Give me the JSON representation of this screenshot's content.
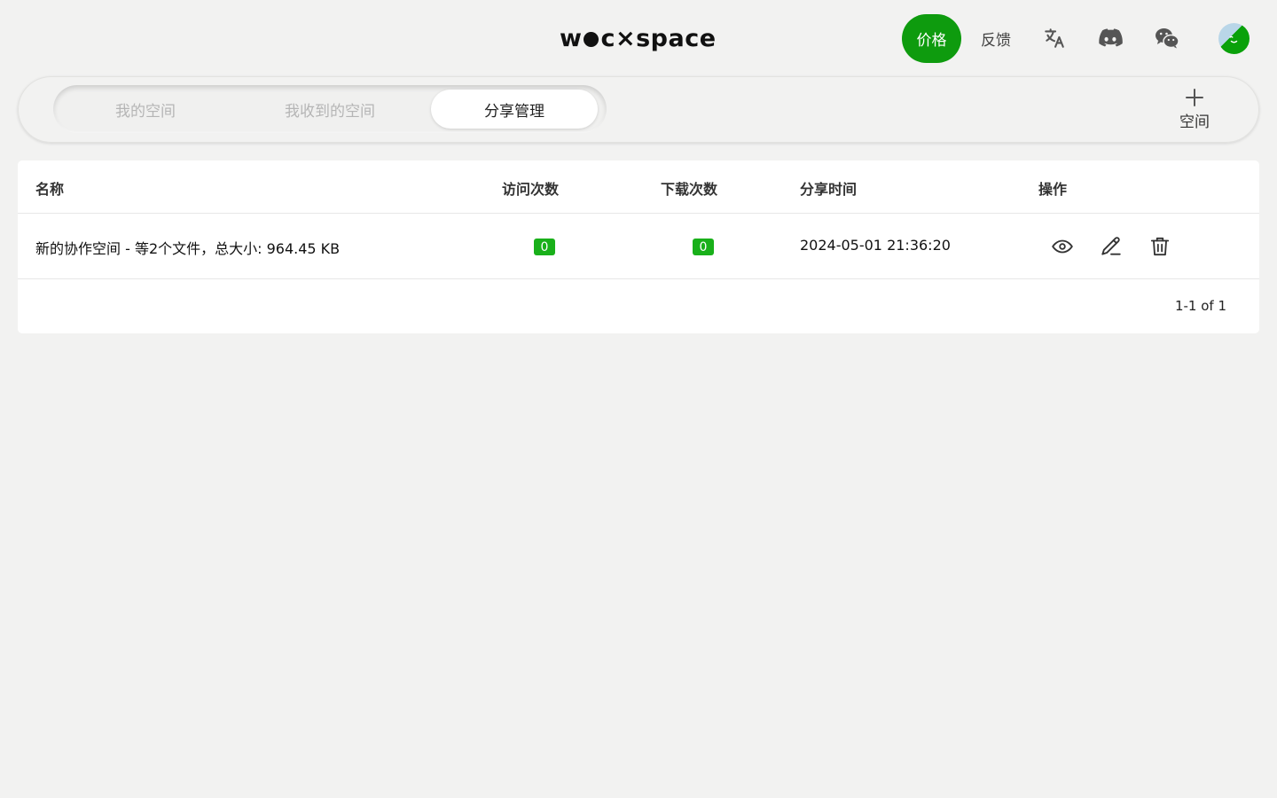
{
  "header": {
    "logo_left": "w",
    "logo_mid": "c",
    "logo_x": "×",
    "logo_right": "space",
    "price_label": "价格",
    "feedback_label": "反馈",
    "icons": [
      "translate-icon",
      "discord-icon",
      "wechat-icon"
    ]
  },
  "tabs": [
    {
      "label": "我的空间",
      "active": false
    },
    {
      "label": "我收到的空间",
      "active": false
    },
    {
      "label": "分享管理",
      "active": true
    }
  ],
  "add_space": {
    "icon": "plus-icon",
    "label": "空间"
  },
  "table": {
    "columns": [
      "名称",
      "访问次数",
      "下载次数",
      "分享时间",
      "操作"
    ],
    "rows": [
      {
        "name": "新的协作空间 - 等2个文件，总大小: 964.45 KB",
        "visits": "0",
        "downloads": "0",
        "shared_at": "2024-05-01 21:36:20",
        "actions": [
          "view-icon",
          "edit-icon",
          "delete-icon"
        ]
      }
    ],
    "pagination": "1-1 of 1"
  },
  "colors": {
    "accent": "#0e9b0e",
    "badge": "#19b01a",
    "background": "#f2f2f1"
  }
}
